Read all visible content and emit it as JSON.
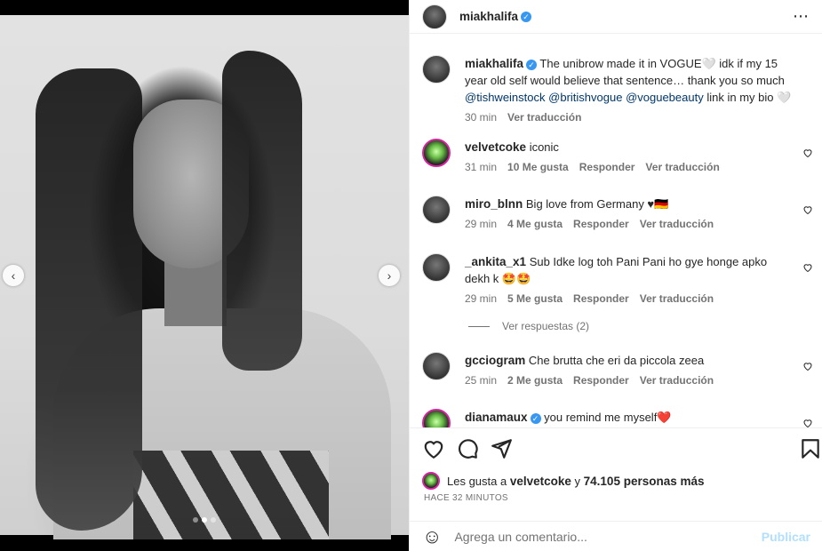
{
  "post": {
    "username": "miakhalifa",
    "verified_mark": "✓",
    "more_icon": "⋯",
    "caption": {
      "username": "miakhalifa",
      "text": "The unibrow made it in VOGUE🤍 idk if my 15 year old self would believe that sentence… thank you so much",
      "mentions": [
        "@tishweinstock",
        "@britishvogue",
        "@voguebeauty"
      ],
      "suffix": "link in my bio 🤍",
      "time": "30 min",
      "translate": "Ver traducción"
    }
  },
  "comments": [
    {
      "username": "velvetcoke",
      "text": "iconic",
      "time": "31 min",
      "likes": "10 Me gusta",
      "reply": "Responder",
      "translate": "Ver traducción"
    },
    {
      "username": "miro_blnn",
      "text": "Big love from Germany ♥🇩🇪",
      "time": "29 min",
      "likes": "4 Me gusta",
      "reply": "Responder",
      "translate": "Ver traducción"
    },
    {
      "username": "_ankita_x1",
      "text": "Sub Idke log toh Pani Pani ho gye honge apko dekh k 🤩🤩",
      "time": "29 min",
      "likes": "5 Me gusta",
      "reply": "Responder",
      "translate": "Ver traducción"
    },
    {
      "username": "gcciogram",
      "text": "Che brutta che eri da piccola zeea",
      "time": "25 min",
      "likes": "2 Me gusta",
      "reply": "Responder",
      "translate": "Ver traducción"
    },
    {
      "username": "dianamaux",
      "text": "you remind me myself❤️",
      "time": "",
      "likes": "",
      "reply": "",
      "translate": ""
    }
  ],
  "view_replies": "Ver respuestas (2)",
  "likes_summary": {
    "prefix": "Les gusta a",
    "user": "velvetcoke",
    "middle": "y",
    "count": "74.105 personas más"
  },
  "posted_ago": "HACE 32 MINUTOS",
  "composer": {
    "placeholder": "Agrega un comentario...",
    "publish": "Publicar",
    "emoji_icon": "☺"
  },
  "carousel": {
    "prev": "‹",
    "next": "›",
    "slides": 3,
    "active": 2
  }
}
